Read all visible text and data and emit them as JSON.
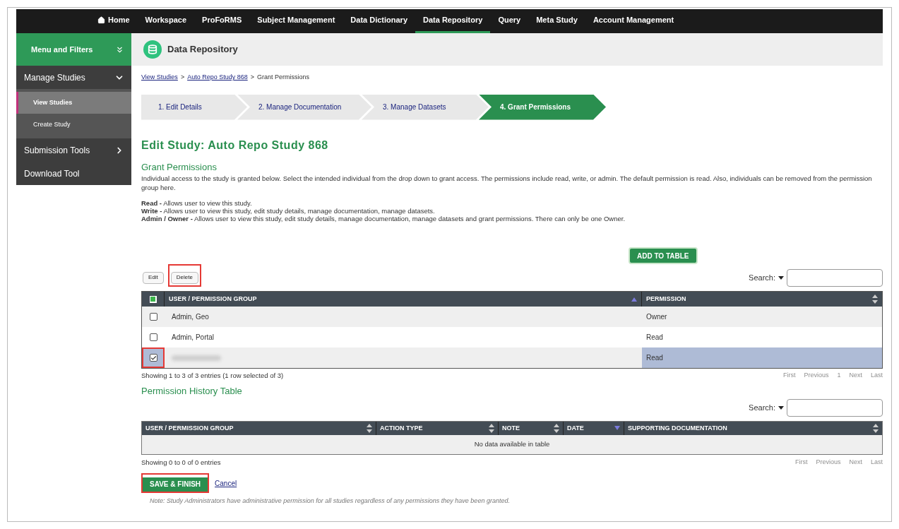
{
  "top_nav": [
    {
      "label": "Home",
      "kind": "home",
      "selected": false
    },
    {
      "label": "Workspace",
      "selected": false
    },
    {
      "label": "ProFoRMS",
      "selected": false
    },
    {
      "label": "Subject Management",
      "selected": false
    },
    {
      "label": "Data Dictionary",
      "selected": false
    },
    {
      "label": "Data Repository",
      "selected": true
    },
    {
      "label": "Query",
      "selected": false
    },
    {
      "label": "Meta Study",
      "selected": false
    },
    {
      "label": "Account Management",
      "selected": false
    }
  ],
  "sidebar": {
    "title": "Menu and Filters",
    "expanded": true,
    "items": [
      {
        "label": "Manage Studies",
        "expanded": true,
        "children": [
          {
            "label": "View Studies",
            "selected": true
          },
          {
            "label": "Create Study",
            "selected": false
          }
        ]
      },
      {
        "label": "Submission Tools",
        "expanded": false
      },
      {
        "label": "Download Tool"
      }
    ]
  },
  "page_header": {
    "title": "Data Repository"
  },
  "breadcrumb": [
    {
      "label": "View Studies",
      "kind": "link"
    },
    {
      "separator": ">",
      "label": "Auto Repo Study 868",
      "kind": "link"
    },
    {
      "separator": ">",
      "label": "Grant Permissions",
      "kind": "current"
    }
  ],
  "steps": [
    {
      "label": "1. Edit Details",
      "selected": false
    },
    {
      "label": "2. Manage Documentation",
      "selected": false
    },
    {
      "label": "3. Manage Datasets",
      "selected": false
    },
    {
      "label": "4. Grant Permissions",
      "selected": true
    }
  ],
  "heading": "Edit Study: Auto Repo Study 868",
  "section_title": "Grant Permissions",
  "intro": "Individual access to the study is granted below. Select the intended individual from the drop down to grant access. The permissions include read, write, or admin. The default permission is read. Also, individuals can be removed from the permission group here.",
  "definitions": [
    "**Read -** Allows user to view this study.",
    "**Write -** Allows user to view this study, edit study details, manage documentation, manage datasets.",
    "**Admin / Owner -** Allows user to view this study, edit study details, manage documentation, manage datasets and grant permissions. There can only be one Owner."
  ],
  "add_button": "ADD TO TABLE",
  "table_buttons": [
    {
      "label": "Edit",
      "highlighted": false
    },
    {
      "label": "Delete",
      "highlighted": true
    }
  ],
  "search_label": "Search:",
  "permissions_table": {
    "select_all_partial": true,
    "columns": [
      {
        "label": "USER / PERMISSION GROUP",
        "sort_ascending": true,
        "sort_descending": false
      },
      {
        "label": "PERMISSION",
        "sort_ascending": false,
        "sort_descending": false
      }
    ],
    "rows": [
      {
        "user": "Admin, Geo",
        "permission": "Owner",
        "selected": false,
        "highlighted": false
      },
      {
        "user": "Admin, Portal",
        "permission": "Read",
        "selected": false,
        "highlighted": false
      },
      {
        "redacted": true,
        "permission": "Read",
        "selected": true,
        "highlighted": true
      }
    ],
    "info": "Showing 1 to 3 of 3 entries (1 row selected of 3)",
    "pagination": [
      {
        "label": "First",
        "disabled": true
      },
      {
        "label": "Previous",
        "disabled": true
      },
      {
        "label": "1",
        "disabled": true
      },
      {
        "label": "Next",
        "disabled": true
      },
      {
        "label": "Last",
        "disabled": true
      }
    ]
  },
  "history_title": "Permission History Table",
  "history_search_label": "Search:",
  "history_table": {
    "columns": [
      {
        "label": "USER / PERMISSION GROUP",
        "sort_ascending": false,
        "sort_descending": false
      },
      {
        "label": "ACTION TYPE",
        "sort_ascending": false,
        "sort_descending": false
      },
      {
        "label": "NOTE",
        "sort_ascending": false,
        "sort_descending": false
      },
      {
        "label": "DATE",
        "sort_ascending": false,
        "sort_descending": true
      },
      {
        "label": "SUPPORTING DOCUMENTATION",
        "sort_ascending": false,
        "sort_descending": false
      }
    ],
    "empty": "No data available in table",
    "info": "Showing 0 to 0 of 0 entries",
    "pagination": [
      {
        "label": "First",
        "disabled": true
      },
      {
        "label": "Previous",
        "disabled": true
      },
      {
        "label": "Next",
        "disabled": true
      },
      {
        "label": "Last",
        "disabled": true
      }
    ]
  },
  "save_button": {
    "label": "SAVE & FINISH",
    "highlighted": true
  },
  "cancel_link": "Cancel",
  "note": "Note: Study Administrators have administrative permission for all studies regardless of any permissions they have been granted."
}
